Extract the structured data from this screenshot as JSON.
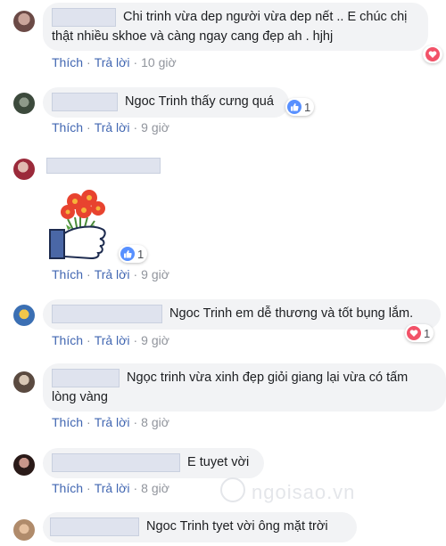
{
  "actions": {
    "like": "Thích",
    "reply": "Trả lời",
    "separator": "·"
  },
  "comments": [
    {
      "line1": "Chi trinh vừa dep người vừa dep nết .. E chúc chị",
      "line2": "thật nhiều skhoe và càng ngay cang đẹp ah . hjhj",
      "time": "10 giờ",
      "reaction": {
        "type": "heart",
        "count": ""
      }
    },
    {
      "text": "Ngoc Trinh thấy cưng quá",
      "time": "9 giờ",
      "reaction": {
        "type": "like",
        "count": "1"
      }
    },
    {
      "sticker": "flowers-thumbs-up-sticker",
      "time": "9 giờ",
      "reaction": {
        "type": "like",
        "count": "1"
      }
    },
    {
      "text": "Ngoc Trinh em dễ thương và tốt bụng lắm.",
      "time": "9 giờ",
      "reaction": {
        "type": "heart",
        "count": "1"
      }
    },
    {
      "line1": "Ngọc trinh vừa xinh đẹp giỏi giang lại vừa có tấm",
      "line2": "lòng vàng",
      "time": "8 giờ"
    },
    {
      "text": "E tuyet vời",
      "time": "8 giờ"
    },
    {
      "text": "Ngoc Trinh tyet vời ông mặt trời"
    }
  ],
  "watermark": "ngoisao.vn",
  "colors": {
    "link": "#4267b2",
    "bubble": "#f2f3f5",
    "like": "#5890ff",
    "heart": "#f25268"
  }
}
